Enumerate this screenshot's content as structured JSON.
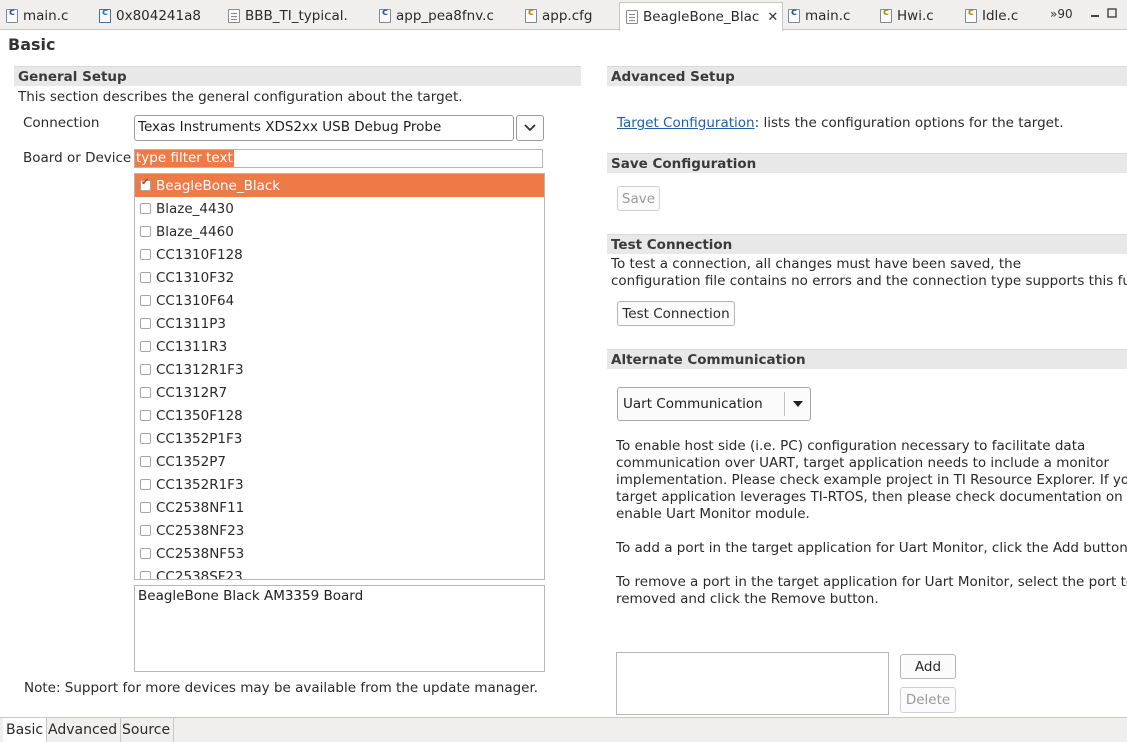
{
  "tabs": [
    {
      "label": "main.c",
      "icon": "c-file-icon"
    },
    {
      "label": "0x804241a8",
      "icon": "memory-file-icon"
    },
    {
      "label": "BBB_TI_typical.",
      "icon": "text-file-icon"
    },
    {
      "label": "app_pea8fnv.c",
      "icon": "c-file-icon"
    },
    {
      "label": "app.cfg",
      "icon": "cfg-file-icon"
    },
    {
      "label": "BeagleBone_Blac",
      "icon": "config-file-icon",
      "active": true
    },
    {
      "label": "main.c",
      "icon": "c-file-icon"
    },
    {
      "label": "Hwi.c",
      "icon": "c-file-icon"
    },
    {
      "label": "Idle.c",
      "icon": "c-file-icon"
    }
  ],
  "tab_overflow": "»90",
  "page_title": "Basic",
  "general": {
    "header": "General Setup",
    "description": "This section describes the general configuration about the target.",
    "connection_label": "Connection",
    "connection_value": "Texas Instruments XDS2xx USB Debug Probe",
    "board_label": "Board or Device",
    "filter_placeholder": "type filter text",
    "devices": [
      {
        "name": "BeagleBone_Black",
        "checked": true
      },
      {
        "name": "Blaze_4430",
        "checked": false
      },
      {
        "name": "Blaze_4460",
        "checked": false
      },
      {
        "name": "CC1310F128",
        "checked": false
      },
      {
        "name": "CC1310F32",
        "checked": false
      },
      {
        "name": "CC1310F64",
        "checked": false
      },
      {
        "name": "CC1311P3",
        "checked": false
      },
      {
        "name": "CC1311R3",
        "checked": false
      },
      {
        "name": "CC1312R1F3",
        "checked": false
      },
      {
        "name": "CC1312R7",
        "checked": false
      },
      {
        "name": "CC1350F128",
        "checked": false
      },
      {
        "name": "CC1352P1F3",
        "checked": false
      },
      {
        "name": "CC1352P7",
        "checked": false
      },
      {
        "name": "CC1352R1F3",
        "checked": false
      },
      {
        "name": "CC2538NF11",
        "checked": false
      },
      {
        "name": "CC2538NF23",
        "checked": false
      },
      {
        "name": "CC2538NF53",
        "checked": false
      },
      {
        "name": "CC2538SF23",
        "checked": false
      }
    ],
    "description_box": "BeagleBone Black AM3359 Board",
    "note": "Note: Support for more devices may be available from the update manager."
  },
  "advanced": {
    "header": "Advanced Setup",
    "link": "Target Configuration",
    "link_suffix": ": lists the configuration options for the target."
  },
  "save": {
    "header": "Save Configuration",
    "button": "Save"
  },
  "test": {
    "header": "Test Connection",
    "line1": "To test a connection, all changes must have been saved, the",
    "line2": "configuration file contains no errors and the connection type supports this fur",
    "button": "Test Connection"
  },
  "alternate": {
    "header": "Alternate Communication",
    "select_value": "Uart Communication",
    "para1": [
      "To enable host side (i.e. PC) configuration necessary to facilitate data",
      "communication over UART, target application needs to include a monitor",
      "implementation. Please check example project in TI Resource Explorer. If you",
      "target application leverages TI-RTOS, then please check documentation on ho",
      "enable Uart Monitor module."
    ],
    "para2": "To add a port in the target application for Uart Monitor, click the Add button",
    "para3": [
      "To remove a port in the target application for Uart Monitor, select the port to",
      "removed and click the Remove button."
    ],
    "add_button": "Add",
    "delete_button": "Delete"
  },
  "bottom_tabs": [
    "Basic",
    "Advanced",
    "Source"
  ],
  "colors": {
    "accent": "#ee7a48",
    "label": "#e0703a",
    "link": "#1f5fa8"
  }
}
